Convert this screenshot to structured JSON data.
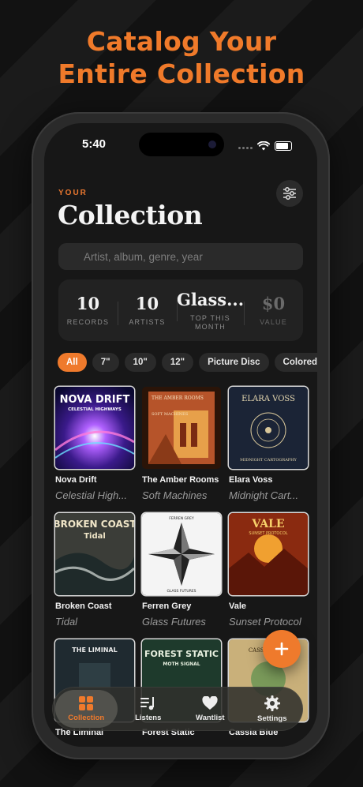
{
  "headline": {
    "line1": "Catalog Your",
    "line2": "Entire Collection"
  },
  "status_bar": {
    "time": "5:40"
  },
  "header": {
    "eyebrow": "YOUR",
    "title": "Collection",
    "filter_icon": "sliders-icon"
  },
  "search": {
    "placeholder": "Artist, album, genre, year",
    "value": ""
  },
  "stats": [
    {
      "value": "10",
      "label": "RECORDS"
    },
    {
      "value": "10",
      "label": "ARTISTS"
    },
    {
      "value": "Glass...",
      "label": "TOP THIS MONTH"
    },
    {
      "value": "$0",
      "label": "VALUE"
    }
  ],
  "filters": {
    "chips": [
      "All",
      "7\"",
      "10\"",
      "12\"",
      "Picture Disc",
      "Colored"
    ],
    "selected": "All"
  },
  "records": [
    {
      "artist": "Nova Drift",
      "album": "Celestial High...",
      "cover_text": "NOVA DRIFT",
      "cover_sub": "CELESTIAL HIGHWAYS"
    },
    {
      "artist": "The Amber Rooms",
      "album": "Soft Machines",
      "cover_text": "THE AMBER ROOMS",
      "cover_sub": "SOFT MACHINES"
    },
    {
      "artist": "Elara Voss",
      "album": "Midnight Cart...",
      "cover_text": "ELARA VOSS",
      "cover_sub": "MIDNIGHT CARTOGRAPHY"
    },
    {
      "artist": "Broken Coast",
      "album": "Tidal",
      "cover_text": "BROKEN COAST",
      "cover_sub": "Tidal"
    },
    {
      "artist": "Ferren Grey",
      "album": "Glass Futures",
      "cover_text": "FERREN GREY",
      "cover_sub": "GLASS FUTURES"
    },
    {
      "artist": "Vale",
      "album": "Sunset Protocol",
      "cover_text": "VALE",
      "cover_sub": "SUNSET PROTOCOL"
    },
    {
      "artist": "The Liminal",
      "album": "",
      "cover_text": "THE LIMINAL",
      "cover_sub": ""
    },
    {
      "artist": "Forest Static",
      "album": "",
      "cover_text": "FOREST STATIC",
      "cover_sub": "MOTH SIGNAL"
    },
    {
      "artist": "Cassia Blue",
      "album": "",
      "cover_text": "CASSIA BLUE",
      "cover_sub": ""
    }
  ],
  "tabbar": {
    "tabs": [
      {
        "label": "Collection",
        "icon": "grid-icon",
        "active": true
      },
      {
        "label": "Listens",
        "icon": "music-list-icon",
        "active": false
      },
      {
        "label": "Wantlist",
        "icon": "heart-icon",
        "active": false
      },
      {
        "label": "Settings",
        "icon": "gear-icon",
        "active": false
      }
    ]
  },
  "colors": {
    "accent": "#ef7a2c",
    "background": "#171717",
    "card": "#222222",
    "text": "#f4f4f4",
    "muted": "#9a9a9a"
  }
}
